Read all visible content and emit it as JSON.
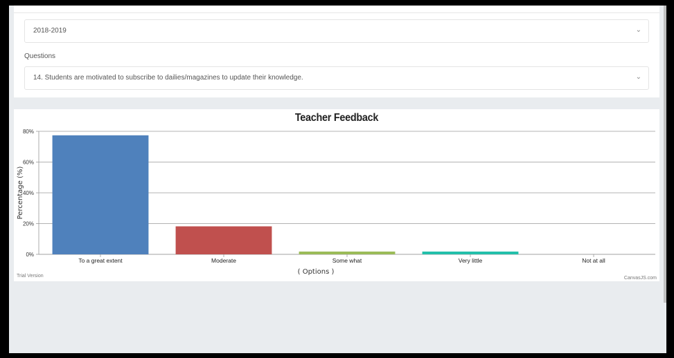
{
  "filters": {
    "year_value": "2018-2019",
    "questions_label": "Questions",
    "question_value": "14. Students are motivated to subscribe to dailies/magazines to update their knowledge."
  },
  "chart_data": {
    "type": "bar",
    "title": "Teacher Feedback",
    "xlabel": "( Options )",
    "ylabel": "Percentage (%)",
    "categories": [
      "To a great extent",
      "Moderate",
      "Some what",
      "Very little",
      "Not at all"
    ],
    "values": [
      77.4,
      18.2,
      1.8,
      1.8,
      0
    ],
    "colors": [
      "#4f81bc",
      "#c0504e",
      "#9bbb58",
      "#23bfaa",
      "#8064a1"
    ],
    "ylim": [
      0,
      80
    ],
    "yticks": [
      0,
      20,
      40,
      60,
      80
    ],
    "ytick_suffix": "%",
    "grid": true,
    "credit_left": "Trial Version",
    "credit_right": "CanvasJS.com"
  }
}
